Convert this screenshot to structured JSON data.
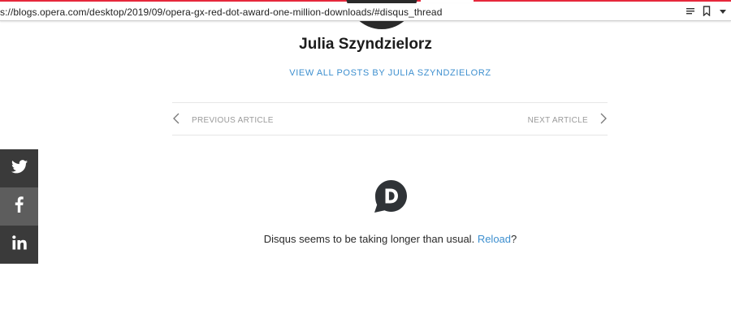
{
  "browser": {
    "url": "s://blogs.opera.com/desktop/2019/09/opera-gx-red-dot-award-one-million-downloads/#disqus_thread",
    "accent_color": "#e6283c",
    "icons": [
      "reader-mode-icon",
      "bookmark-icon",
      "dropdown-arrow-icon"
    ]
  },
  "author": {
    "name": "Julia Szyndzielorz",
    "view_all_label": "VIEW ALL POSTS BY JULIA SZYNDZIELORZ",
    "link_color": "#3d8fcf"
  },
  "article_nav": {
    "previous_label": "PREVIOUS ARTICLE",
    "next_label": "NEXT ARTICLE"
  },
  "share": {
    "items": [
      {
        "network": "twitter",
        "icon": "twitter-icon"
      },
      {
        "network": "facebook",
        "icon": "facebook-icon"
      },
      {
        "network": "linkedin",
        "icon": "linkedin-icon"
      }
    ]
  },
  "disqus": {
    "logo_icon": "disqus-icon",
    "message_prefix": "Disqus seems to be taking longer than usual.",
    "reload_label": "Reload",
    "message_suffix": "?"
  }
}
